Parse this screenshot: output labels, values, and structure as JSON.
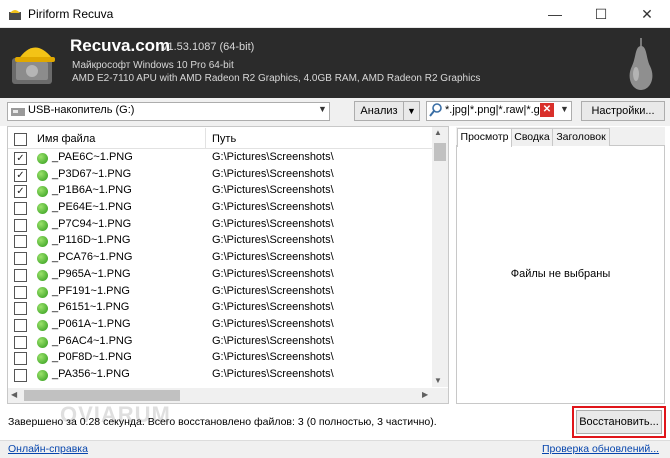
{
  "window": {
    "title": "Piriform Recuva",
    "minimize_glyph": "—",
    "maximize_glyph": "☐",
    "close_glyph": "✕"
  },
  "header": {
    "brand": "Recuva.com",
    "version": "v1.53.1087 (64-bit)",
    "os_line": "Майкрософт Windows 10 Pro 64-bit",
    "hardware_line": "AMD E2-7110 APU with AMD Radeon R2 Graphics, 4.0GB RAM, AMD Radeon R2 Graphics"
  },
  "toolbar": {
    "drive_value": "USB-накопитель (G:)",
    "drive_arrow": "▼",
    "scan_label": "Анализ",
    "scan_dropdown": "▼",
    "filter_value": "*.jpg|*.png|*.raw|*.gif",
    "filter_clear": "✕",
    "filter_arrow": "▼",
    "settings_label": "Настройки..."
  },
  "file_list": {
    "columns": [
      "Имя файла",
      "Путь"
    ],
    "rows": [
      {
        "name": "_PAE6C~1.PNG",
        "path": "G:\\Pictures\\Screenshots\\",
        "checked": true
      },
      {
        "name": "_P3D67~1.PNG",
        "path": "G:\\Pictures\\Screenshots\\",
        "checked": true
      },
      {
        "name": "_P1B6A~1.PNG",
        "path": "G:\\Pictures\\Screenshots\\",
        "checked": true
      },
      {
        "name": "_PE64E~1.PNG",
        "path": "G:\\Pictures\\Screenshots\\",
        "checked": false
      },
      {
        "name": "_P7C94~1.PNG",
        "path": "G:\\Pictures\\Screenshots\\",
        "checked": false
      },
      {
        "name": "_P116D~1.PNG",
        "path": "G:\\Pictures\\Screenshots\\",
        "checked": false
      },
      {
        "name": "_PCA76~1.PNG",
        "path": "G:\\Pictures\\Screenshots\\",
        "checked": false
      },
      {
        "name": "_P965A~1.PNG",
        "path": "G:\\Pictures\\Screenshots\\",
        "checked": false
      },
      {
        "name": "_PF191~1.PNG",
        "path": "G:\\Pictures\\Screenshots\\",
        "checked": false
      },
      {
        "name": "_P6151~1.PNG",
        "path": "G:\\Pictures\\Screenshots\\",
        "checked": false
      },
      {
        "name": "_P061A~1.PNG",
        "path": "G:\\Pictures\\Screenshots\\",
        "checked": false
      },
      {
        "name": "_P6AC4~1.PNG",
        "path": "G:\\Pictures\\Screenshots\\",
        "checked": false
      },
      {
        "name": "_P0F8D~1.PNG",
        "path": "G:\\Pictures\\Screenshots\\",
        "checked": false
      },
      {
        "name": "_PA356~1.PNG",
        "path": "G:\\Pictures\\Screenshots\\",
        "checked": false
      }
    ],
    "state_color": "#3fae2a"
  },
  "scrollbar_glyphs": {
    "up": "▲",
    "down": "▼",
    "left": "◀",
    "right": "▶"
  },
  "preview": {
    "tabs": [
      "Просмотр",
      "Сводка",
      "Заголовок"
    ],
    "empty_message": "Файлы не выбраны"
  },
  "status": {
    "message": "Завершено за 0.28 секунда. Всего восстановлено файлов: 3 (0 полностью, 3 частично).",
    "restore_label": "Восстановить...",
    "highlight_color": "#e0151a"
  },
  "watermark": "OVIARUM",
  "footer": {
    "help_link": "Онлайн-справка",
    "update_link": "Проверка обновлений..."
  }
}
